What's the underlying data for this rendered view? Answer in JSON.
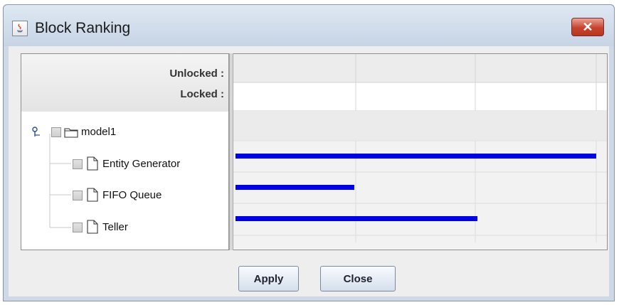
{
  "window": {
    "title": "Block Ranking",
    "close_glyph": "✕"
  },
  "header": {
    "unlocked_label": "Unlocked :",
    "locked_label": "Locked :"
  },
  "tree": {
    "root": {
      "label": "model1",
      "icon": "folder-icon",
      "checked": false
    },
    "children": [
      {
        "label": "Entity Generator",
        "icon": "document-icon",
        "checked": false,
        "rank": 1.0
      },
      {
        "label": "FIFO Queue",
        "icon": "document-icon",
        "checked": false,
        "rank": 0.33
      },
      {
        "label": "Teller",
        "icon": "document-icon",
        "checked": false,
        "rank": 0.67
      }
    ]
  },
  "chart": {
    "bar_color": "#0000e6"
  },
  "buttons": {
    "apply_label": "Apply",
    "close_label": "Close"
  }
}
